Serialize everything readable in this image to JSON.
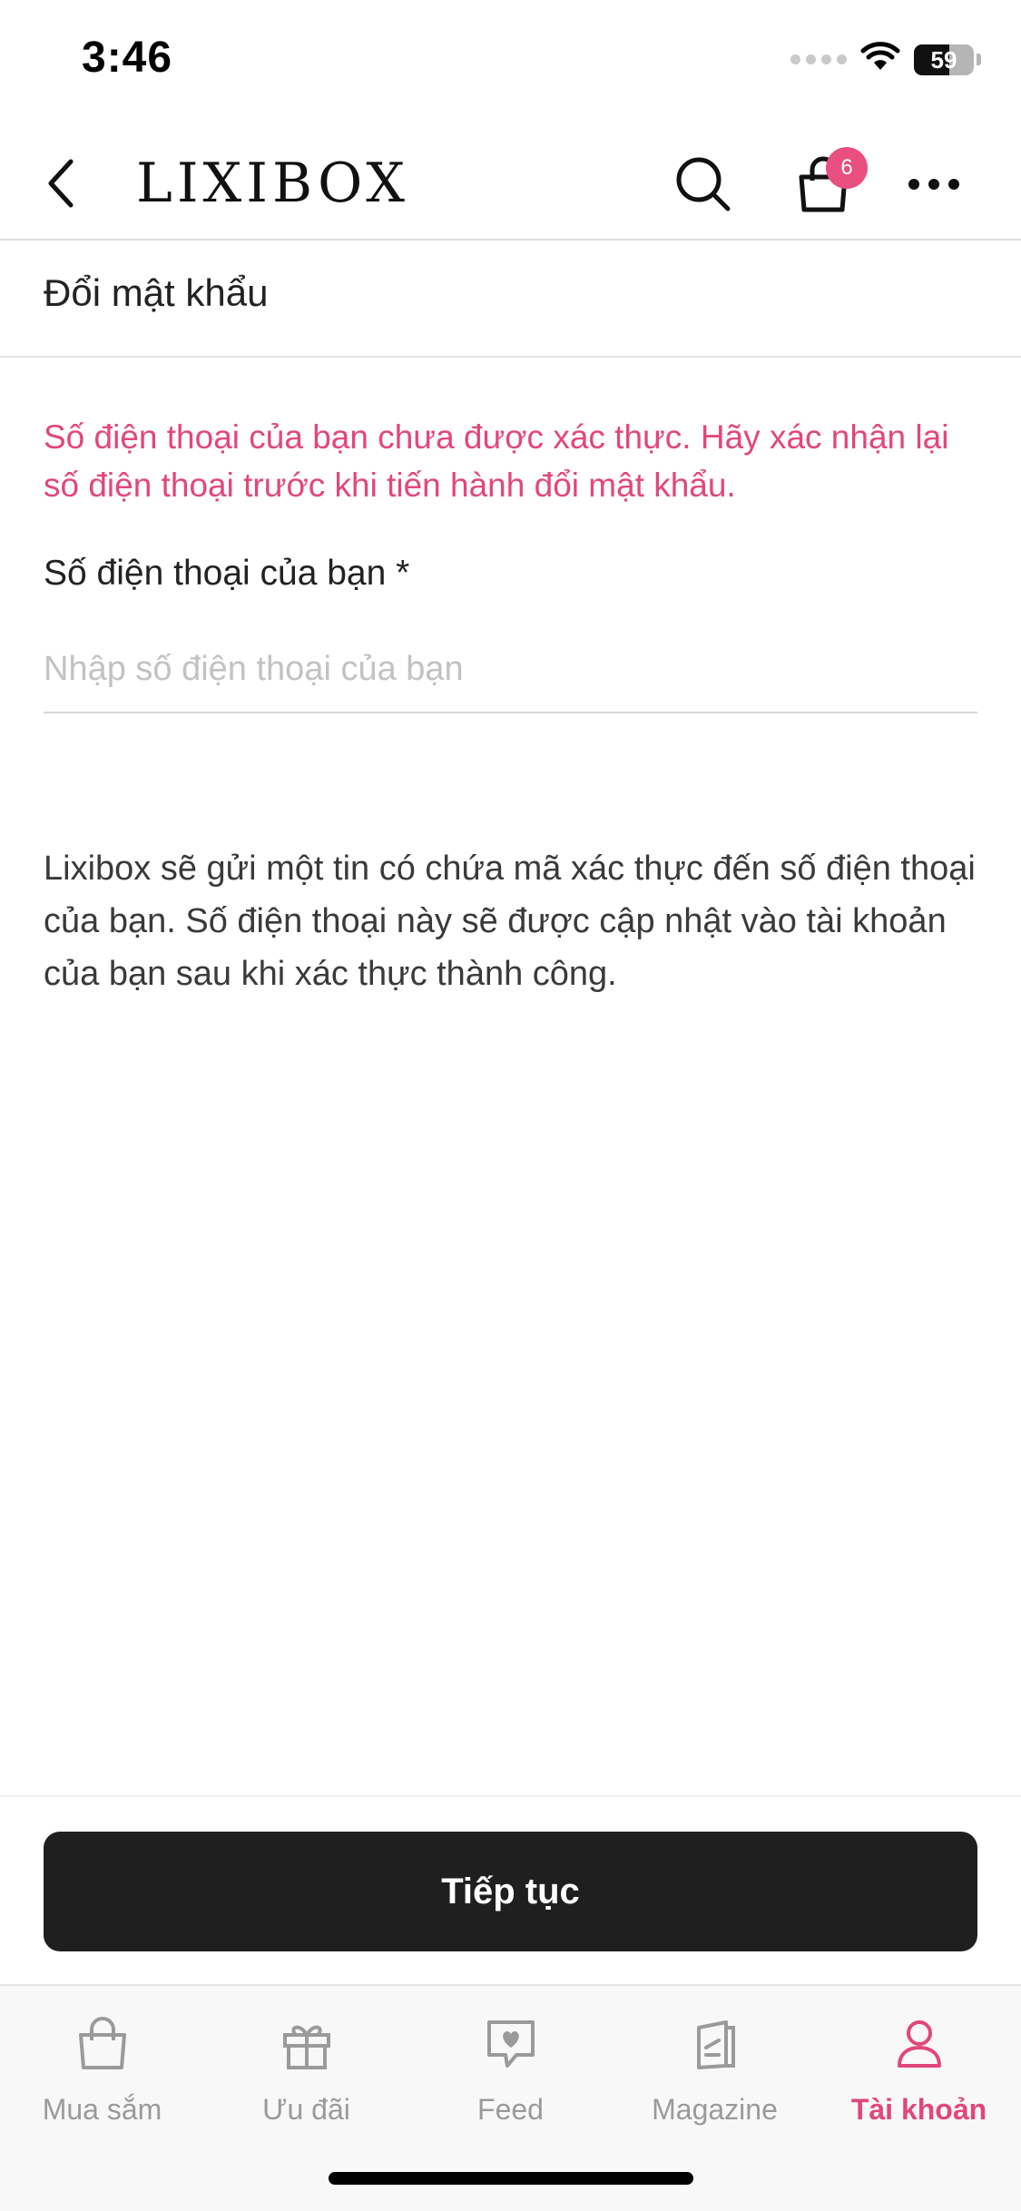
{
  "status_bar": {
    "time": "3:46",
    "battery": 59
  },
  "header": {
    "logo": "LIXIBOX",
    "cart_badge": "6"
  },
  "page": {
    "title": "Đổi mật khẩu",
    "warning": "Số điện thoại của bạn chưa được xác thực. Hãy xác nhận lại số điện thoại trước khi tiến hành đổi mật khẩu.",
    "phone_label": "Số điện thoại của bạn *",
    "phone_placeholder": "Nhập số điện thoại của bạn",
    "phone_value": "",
    "info": "Lixibox sẽ gửi một tin có chứa mã xác thực đến số điện thoại của bạn. Số điện thoại này sẽ được cập nhật vào tài khoản của bạn sau khi xác thực thành công.",
    "continue_label": "Tiếp tục"
  },
  "tabs": [
    {
      "label": "Mua sắm",
      "icon": "shopping-bag-icon",
      "active": false
    },
    {
      "label": "Ưu đãi",
      "icon": "gift-icon",
      "active": false
    },
    {
      "label": "Feed",
      "icon": "heart-chat-icon",
      "active": false
    },
    {
      "label": "Magazine",
      "icon": "magazine-icon",
      "active": false
    },
    {
      "label": "Tài khoản",
      "icon": "user-icon",
      "active": true
    }
  ],
  "colors": {
    "accent": "#e2477a",
    "badge": "#e94f7f",
    "button": "#1f1f1f",
    "inactive_tab": "#9a9a9a"
  }
}
